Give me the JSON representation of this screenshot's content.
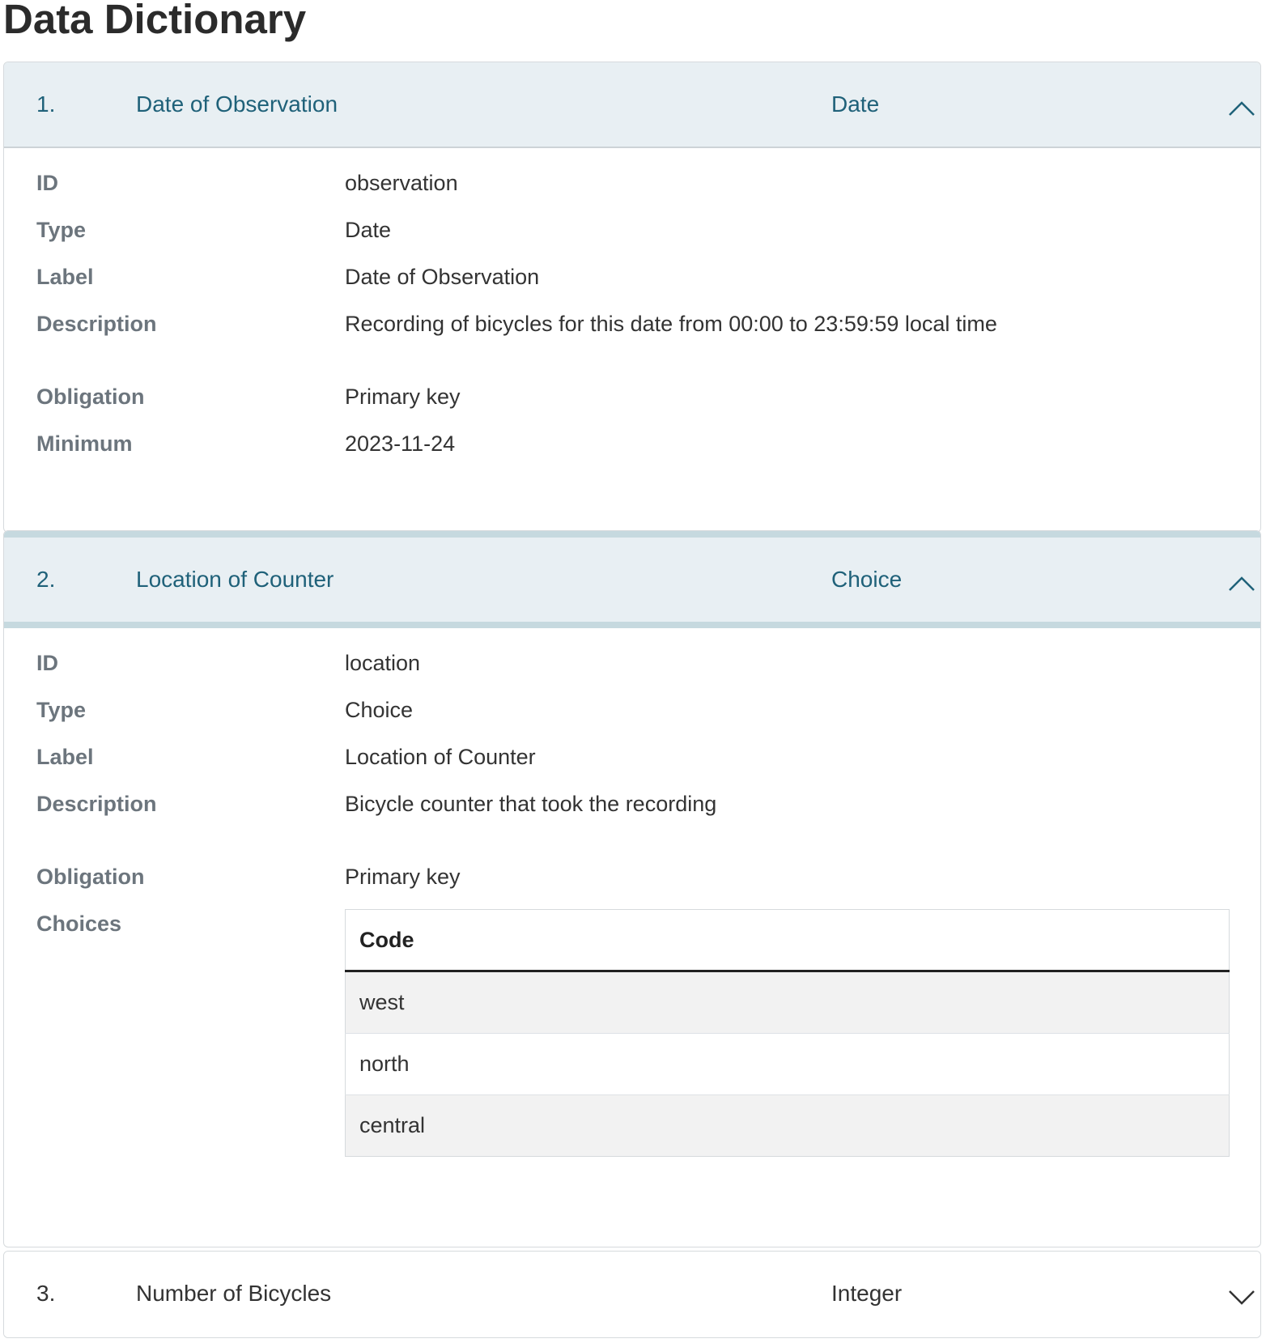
{
  "title": "Data Dictionary",
  "fields": [
    {
      "number": "1.",
      "title": "Date of Observation",
      "type": "Date",
      "expanded": true,
      "rows": [
        [
          "ID",
          "observation"
        ],
        [
          "Type",
          "Date"
        ],
        [
          "Label",
          "Date of Observation"
        ],
        [
          "Description",
          "Recording of bicycles for this date from 00:00 to 23:59:59 local time"
        ],
        [
          "Obligation",
          "Primary key"
        ],
        [
          "Minimum",
          "2023-11-24"
        ]
      ]
    },
    {
      "number": "2.",
      "title": "Location of Counter",
      "type": "Choice",
      "expanded": true,
      "rows": [
        [
          "ID",
          "location"
        ],
        [
          "Type",
          "Choice"
        ],
        [
          "Label",
          "Location of Counter"
        ],
        [
          "Description",
          "Bicycle counter that took the recording"
        ],
        [
          "Obligation",
          "Primary key"
        ],
        [
          "Choices",
          ""
        ]
      ],
      "choices_header": "Code",
      "choices": [
        "west",
        "north",
        "central"
      ]
    },
    {
      "number": "3.",
      "title": "Number of Bicycles",
      "type": "Integer",
      "expanded": false
    }
  ],
  "icons": {
    "expanded": "chevron-up-icon",
    "collapsed": "chevron-down-icon"
  }
}
